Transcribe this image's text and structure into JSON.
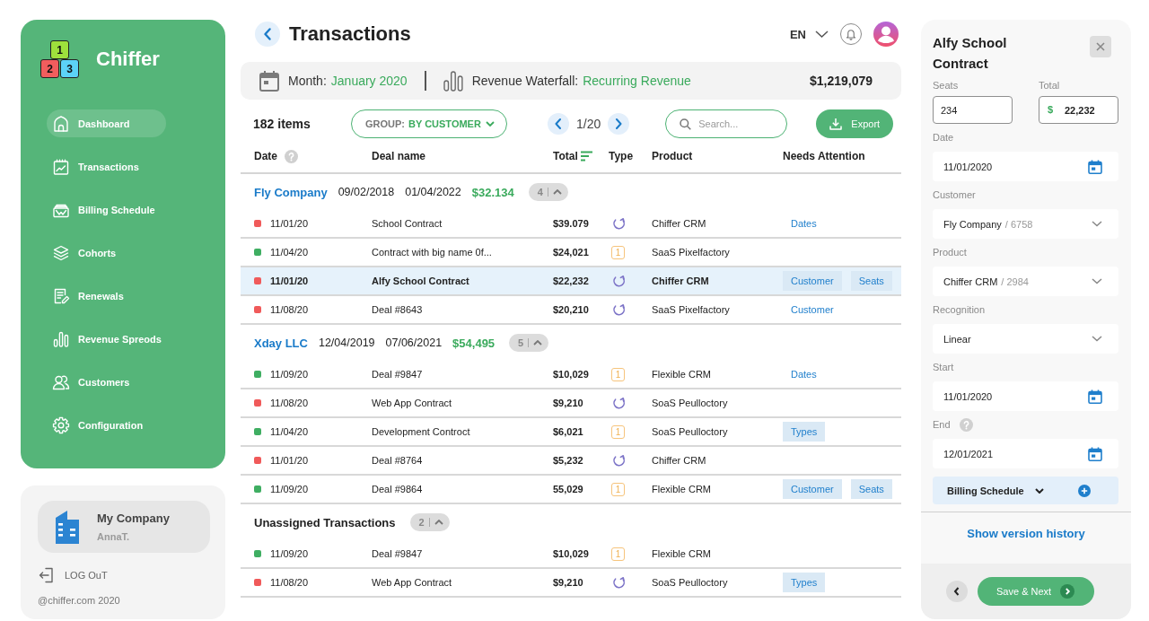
{
  "sidebar": {
    "logo": {
      "blocks": [
        {
          "label": "1",
          "color": "#9ee03c"
        },
        {
          "label": "2",
          "color": "#f25d5d"
        },
        {
          "label": "3",
          "color": "#5cd3f7"
        }
      ],
      "name": "Chiffer"
    },
    "items": [
      {
        "label": "Dashboard",
        "selected": true
      },
      {
        "label": "Transactions",
        "selected": false
      },
      {
        "label": "Billing Schedule",
        "selected": false
      },
      {
        "label": "Cohorts",
        "selected": false
      },
      {
        "label": "Renewals",
        "selected": false
      },
      {
        "label": "Revenue Spreods",
        "selected": false
      },
      {
        "label": "Customers",
        "selected": false
      },
      {
        "label": "Configuration",
        "selected": false
      }
    ]
  },
  "account": {
    "company": "My Company",
    "user": "AnnaT.",
    "logout": "LOG OuT",
    "copyright": "@chiffer.com 2020"
  },
  "header": {
    "title": "Transactions",
    "language": "EN"
  },
  "summary": {
    "month_label": "Month:",
    "month": "January 2020",
    "waterfall_label": "Revenue Waterfall:",
    "waterfall": "Recurring Revenue",
    "total": "$1,219,079"
  },
  "toolbar": {
    "count": "182 items",
    "group_label": "GROUP:",
    "group_value": "BY CUSTOMER",
    "page": "1/20",
    "search": {
      "placeholder": "Search..."
    },
    "export": "Export"
  },
  "table": {
    "columns": [
      "Date",
      "Deal name",
      "Total",
      "Type",
      "Product",
      "Needs Attention"
    ],
    "groups": [
      {
        "kind": "customer",
        "name": "Fly Company",
        "start": "09/02/2018",
        "end": "01/04/2022",
        "total": "$32.134",
        "count": "4",
        "expanded": true,
        "rows": [
          {
            "color": "#f05a5a",
            "date": "11/01/20",
            "deal": "School Contract",
            "total": "$39.079",
            "type": {
              "kind": "recurring"
            },
            "product": "Chiffer CRM",
            "attention": [
              {
                "kind": "link",
                "label": "Dates"
              }
            ],
            "selected": false
          },
          {
            "color": "#3fae62",
            "date": "11/04/20",
            "deal": "Contract with big name 0f...",
            "total": "$24,021",
            "type": {
              "kind": "single",
              "label": "1"
            },
            "product": "SaaS Pixelfactory",
            "attention": [],
            "selected": false
          },
          {
            "color": "#f05a5a",
            "date": "11/01/20",
            "deal": "Alfy School Contract",
            "total": "$22,232",
            "type": {
              "kind": "recurring"
            },
            "product": "Chiffer CRM",
            "attention": [
              {
                "kind": "tag",
                "label": "Customer"
              },
              {
                "kind": "tag",
                "label": "Seats"
              }
            ],
            "selected": true
          },
          {
            "color": "#f05a5a",
            "date": "11/08/20",
            "deal": "Deal #8643",
            "total": "$20,210",
            "type": {
              "kind": "recurring"
            },
            "product": "SaaS Pixelfactory",
            "attention": [
              {
                "kind": "link",
                "label": "Customer"
              }
            ],
            "selected": false
          }
        ]
      },
      {
        "kind": "customer",
        "name": "Xday LLC",
        "start": "12/04/2019",
        "end": "07/06/2021",
        "total": "$54,495",
        "count": "5",
        "expanded": true,
        "rows": [
          {
            "color": "#3fae62",
            "date": "11/09/20",
            "deal": "Deal #9847",
            "total": "$10,029",
            "type": {
              "kind": "single",
              "label": "1"
            },
            "product": "Flexible CRM",
            "attention": [
              {
                "kind": "link",
                "label": "Dates"
              }
            ],
            "selected": false
          },
          {
            "color": "#f05a5a",
            "date": "11/08/20",
            "deal": "Web App Contract",
            "total": "$9,210",
            "type": {
              "kind": "recurring"
            },
            "product": "SoaS Peulloctory",
            "attention": [],
            "selected": false
          },
          {
            "color": "#3fae62",
            "date": "11/04/20",
            "deal": "Development Controct",
            "total": "$6,021",
            "type": {
              "kind": "single",
              "label": "1"
            },
            "product": "SoaS Peulloctory",
            "attention": [
              {
                "kind": "tag",
                "label": "Types"
              }
            ],
            "selected": false
          },
          {
            "color": "#f05a5a",
            "date": "11/01/20",
            "deal": "Deal #8764",
            "total": "$5,232",
            "type": {
              "kind": "recurring"
            },
            "product": "Chiffer CRM",
            "attention": [],
            "selected": false
          },
          {
            "color": "#3fae62",
            "date": "11/09/20",
            "deal": "Deal #9864",
            "total": "55,029",
            "type": {
              "kind": "single",
              "label": "1"
            },
            "product": "Flexible CRM",
            "attention": [
              {
                "kind": "tag",
                "label": "Customer"
              },
              {
                "kind": "tag",
                "label": "Seats"
              }
            ],
            "selected": false
          }
        ]
      },
      {
        "kind": "unassigned",
        "name": "Unassigned Transactions",
        "count": "2",
        "expanded": true,
        "rows": [
          {
            "color": "#3fae62",
            "date": "11/09/20",
            "deal": "Deal #9847",
            "total": "$10,029",
            "type": {
              "kind": "single",
              "label": "1"
            },
            "product": "Flexible CRM",
            "attention": [],
            "selected": false
          },
          {
            "color": "#f05a5a",
            "date": "11/08/20",
            "deal": "Web App Contract",
            "total": "$9,210",
            "type": {
              "kind": "recurring"
            },
            "product": "SoaS Peulloctory",
            "attention": [
              {
                "kind": "tag",
                "label": "Types"
              }
            ],
            "selected": false
          }
        ]
      }
    ]
  },
  "detail": {
    "title": "Alfy School Contract",
    "seats": {
      "label": "Seats",
      "value": "234"
    },
    "total": {
      "label": "Total",
      "currency": "$",
      "value": "22,232"
    },
    "fields": [
      {
        "kind": "date",
        "label": "Date",
        "value": "11/01/2020",
        "help": false
      },
      {
        "kind": "select",
        "label": "Customer",
        "value": "Fly Company",
        "suffix": "/ 6758",
        "help": false
      },
      {
        "kind": "select",
        "label": "Product",
        "value": "Chiffer CRM",
        "suffix": "/ 2984",
        "help": false
      },
      {
        "kind": "select",
        "label": "Recognition",
        "value": "Linear",
        "help": false
      },
      {
        "kind": "date",
        "label": "Start",
        "value": "11/01/2020",
        "help": false
      },
      {
        "kind": "date",
        "label": "End",
        "value": "12/01/2021",
        "help": true
      }
    ],
    "billing": {
      "label": "Billing Schedule",
      "expanded": false
    },
    "history_link": "Show version history",
    "save": "Save & Next"
  }
}
